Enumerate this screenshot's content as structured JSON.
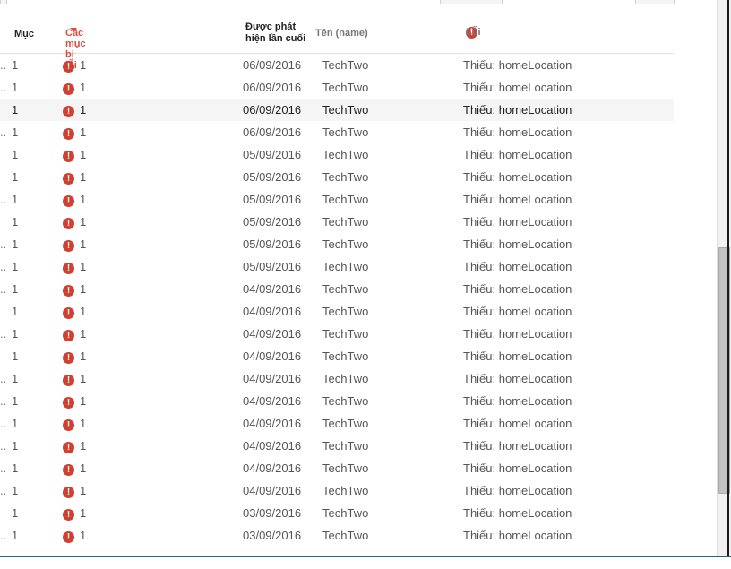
{
  "header": {
    "col_muc": "Mục",
    "col_cac_muc": "Các mục bị lỗi",
    "col_duoc_phat_hien_line1": "Được phát",
    "col_duoc_phat_hien_line2": "hiện lần cuối",
    "col_ten": "Tên (name)",
    "col_loi": "Lỗi",
    "sort_icon": "caret-down-icon",
    "error_icon": "error-circle-icon"
  },
  "colors": {
    "accent": "#dd4b39",
    "error_icon": "#d23f31",
    "highlight_row": "#f5f5f5"
  },
  "rows": [
    {
      "prefix": "..",
      "muc": "1",
      "count": "1",
      "date": "06/09/2016",
      "name": "TechTwo",
      "error": "Thiếu: homeLocation"
    },
    {
      "prefix": "..",
      "muc": "1",
      "count": "1",
      "date": "06/09/2016",
      "name": "TechTwo",
      "error": "Thiếu: homeLocation"
    },
    {
      "prefix": "",
      "muc": "1",
      "count": "1",
      "date": "06/09/2016",
      "name": "TechTwo",
      "error": "Thiếu: homeLocation",
      "highlight": true
    },
    {
      "prefix": "..",
      "muc": "1",
      "count": "1",
      "date": "06/09/2016",
      "name": "TechTwo",
      "error": "Thiếu: homeLocation"
    },
    {
      "prefix": "",
      "muc": "1",
      "count": "1",
      "date": "05/09/2016",
      "name": "TechTwo",
      "error": "Thiếu: homeLocation"
    },
    {
      "prefix": "",
      "muc": "1",
      "count": "1",
      "date": "05/09/2016",
      "name": "TechTwo",
      "error": "Thiếu: homeLocation"
    },
    {
      "prefix": "..",
      "muc": "1",
      "count": "1",
      "date": "05/09/2016",
      "name": "TechTwo",
      "error": "Thiếu: homeLocation"
    },
    {
      "prefix": "",
      "muc": "1",
      "count": "1",
      "date": "05/09/2016",
      "name": "TechTwo",
      "error": "Thiếu: homeLocation"
    },
    {
      "prefix": "..",
      "muc": "1",
      "count": "1",
      "date": "05/09/2016",
      "name": "TechTwo",
      "error": "Thiếu: homeLocation"
    },
    {
      "prefix": "..",
      "muc": "1",
      "count": "1",
      "date": "05/09/2016",
      "name": "TechTwo",
      "error": "Thiếu: homeLocation"
    },
    {
      "prefix": "..",
      "muc": "1",
      "count": "1",
      "date": "04/09/2016",
      "name": "TechTwo",
      "error": "Thiếu: homeLocation"
    },
    {
      "prefix": "",
      "muc": "1",
      "count": "1",
      "date": "04/09/2016",
      "name": "TechTwo",
      "error": "Thiếu: homeLocation"
    },
    {
      "prefix": "..",
      "muc": "1",
      "count": "1",
      "date": "04/09/2016",
      "name": "TechTwo",
      "error": "Thiếu: homeLocation"
    },
    {
      "prefix": "",
      "muc": "1",
      "count": "1",
      "date": "04/09/2016",
      "name": "TechTwo",
      "error": "Thiếu: homeLocation"
    },
    {
      "prefix": "..",
      "muc": "1",
      "count": "1",
      "date": "04/09/2016",
      "name": "TechTwo",
      "error": "Thiếu: homeLocation"
    },
    {
      "prefix": "..",
      "muc": "1",
      "count": "1",
      "date": "04/09/2016",
      "name": "TechTwo",
      "error": "Thiếu: homeLocation"
    },
    {
      "prefix": "..",
      "muc": "1",
      "count": "1",
      "date": "04/09/2016",
      "name": "TechTwo",
      "error": "Thiếu: homeLocation"
    },
    {
      "prefix": "..",
      "muc": "1",
      "count": "1",
      "date": "04/09/2016",
      "name": "TechTwo",
      "error": "Thiếu: homeLocation"
    },
    {
      "prefix": "..",
      "muc": "1",
      "count": "1",
      "date": "04/09/2016",
      "name": "TechTwo",
      "error": "Thiếu: homeLocation"
    },
    {
      "prefix": "..",
      "muc": "1",
      "count": "1",
      "date": "04/09/2016",
      "name": "TechTwo",
      "error": "Thiếu: homeLocation"
    },
    {
      "prefix": "",
      "muc": "1",
      "count": "1",
      "date": "03/09/2016",
      "name": "TechTwo",
      "error": "Thiếu: homeLocation"
    },
    {
      "prefix": "..",
      "muc": "1",
      "count": "1",
      "date": "03/09/2016",
      "name": "TechTwo",
      "error": "Thiếu: homeLocation"
    }
  ]
}
